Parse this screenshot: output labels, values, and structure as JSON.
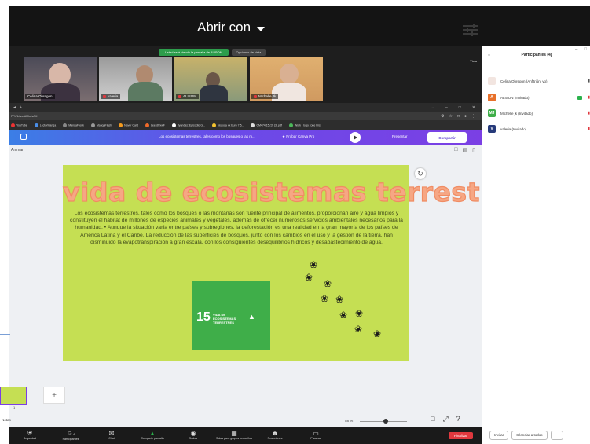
{
  "overlay": {
    "open_with_label": "Abrir con"
  },
  "zoom": {
    "share_notice": "Usted está viendo la pantalla de ALISON",
    "view_options": "Opciones de vista",
    "view_label": "Vista",
    "participants_video": [
      {
        "name": "Celina Obregon",
        "muted": false
      },
      {
        "name": "valeria",
        "muted": true
      },
      {
        "name": "ALISON",
        "muted": true
      },
      {
        "name": "Michelle Jk",
        "muted": true
      }
    ],
    "controls": [
      {
        "label": "Seguridad",
        "icon": "shield-icon"
      },
      {
        "label": "Participantes",
        "icon": "participants-icon",
        "count": "4"
      },
      {
        "label": "Chat",
        "icon": "chat-icon"
      },
      {
        "label": "Compartir pantalla",
        "icon": "share-screen-icon",
        "active": true
      },
      {
        "label": "Grabar",
        "icon": "record-icon"
      },
      {
        "label": "Salas para grupos pequeños",
        "icon": "breakout-icon"
      },
      {
        "label": "Reacciones",
        "icon": "reactions-icon"
      },
      {
        "label": "Pizarras",
        "icon": "whiteboard-icon"
      }
    ],
    "end_label": "Finalizar"
  },
  "browser": {
    "tab_label": "+",
    "url": "PFL/1/rvwrAMlulivAM",
    "bookmarks": [
      "YouTube",
      "LectorManga",
      "MangaFrenk",
      "MangaFlash",
      "Naver Card",
      "LeerdlyxwF",
      "Ilyandas: Episodio G...",
      "Veaoga xx Euro 7.5...",
      "CM474 15 (3) (3).pdf",
      "Work - logo zone lms"
    ]
  },
  "canva": {
    "doc_title": "Los ecosistemas terrestres, tales como los bosques o las m...",
    "try_pro": "★ Probar Canva Pro",
    "present": "Presentar",
    "share": "Compartir",
    "animate": "Animar",
    "slide": {
      "title": "vida de ecosistemas terrestres",
      "body": "Los ecosistemas terrestres, tales como los bosques o las montañas son fuente principal de alimentos, proporcionan aire y agua limpios y constituyen el hábitat de millones de especies animales y vegetales, además de ofrecer numerosos servicios ambientales necesarios para la humanidad. • Aunque la situación varía entre países y subregiones, la deforestación es una realidad en la gran mayoría de los países de América Latina y el Caribe. La reducción de las superficies de bosques, junto con los cambios en el uso y la gestión de la tierra, han disminuido la evapotranspiración a gran escala, con los consiguientes desequilibrios hídricos y desabastecimiento de agua.",
      "sdg_number": "15",
      "sdg_text": "VIDA DE ECOSISTEMAS TERRESTRES"
    },
    "page_number": "1",
    "notes": "Notas",
    "zoom_level": "58 %",
    "zoom_fraction": 0.55
  },
  "panel": {
    "title": "Participantes (4)",
    "participants": [
      {
        "name": "Celina Obregon (Anfitrión, yo)",
        "initial": "",
        "color": "#f2e5e0"
      },
      {
        "name": "ALISON (Invitado)",
        "initial": "A",
        "color": "#e8702a"
      },
      {
        "name": "Michelle jk (Invitado)",
        "initial": "MJ",
        "color": "#3fae49"
      },
      {
        "name": "valeria (Invitado)",
        "initial": "V",
        "color": "#263a7a"
      }
    ],
    "invite": "Invitar",
    "mute_all": "Silenciar a todos"
  }
}
